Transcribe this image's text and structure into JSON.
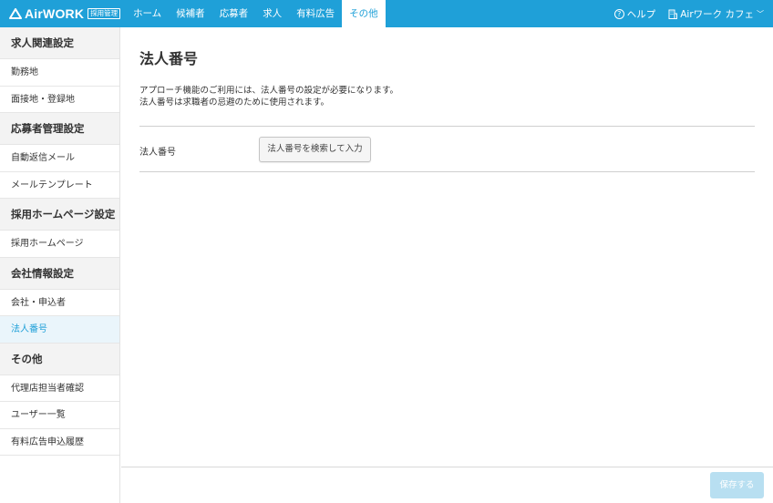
{
  "header": {
    "logo_text": "AirWORK",
    "logo_badge": "採用管理",
    "nav": [
      {
        "label": "ホーム",
        "active": false
      },
      {
        "label": "候補者",
        "active": false
      },
      {
        "label": "応募者",
        "active": false
      },
      {
        "label": "求人",
        "active": false
      },
      {
        "label": "有料広告",
        "active": false
      },
      {
        "label": "その他",
        "active": true
      }
    ],
    "help_label": "ヘルプ",
    "account_label": "Airワーク カフェ",
    "colors": {
      "brand": "#1fa0d8"
    }
  },
  "sidebar": {
    "sections": [
      {
        "title": "求人関連設定",
        "items": [
          {
            "label": "勤務地",
            "active": false
          },
          {
            "label": "面接地・登録地",
            "active": false
          }
        ]
      },
      {
        "title": "応募者管理設定",
        "items": [
          {
            "label": "自動返信メール",
            "active": false
          },
          {
            "label": "メールテンプレート",
            "active": false
          }
        ]
      },
      {
        "title": "採用ホームページ設定",
        "items": [
          {
            "label": "採用ホームページ",
            "active": false
          }
        ]
      },
      {
        "title": "会社情報設定",
        "items": [
          {
            "label": "会社・申込者",
            "active": false
          },
          {
            "label": "法人番号",
            "active": true
          }
        ]
      },
      {
        "title": "その他",
        "items": [
          {
            "label": "代理店担当者確認",
            "active": false
          },
          {
            "label": "ユーザー一覧",
            "active": false
          },
          {
            "label": "有料広告申込履歴",
            "active": false
          }
        ]
      }
    ]
  },
  "main": {
    "title": "法人番号",
    "description_line1": "アプローチ機能のご利用には、法人番号の設定が必要になります。",
    "description_line2": "法人番号は求職者の忌避のために使用されます。",
    "field_label": "法人番号",
    "search_button": "法人番号を検索して入力"
  },
  "footer": {
    "save_button": "保存する"
  }
}
